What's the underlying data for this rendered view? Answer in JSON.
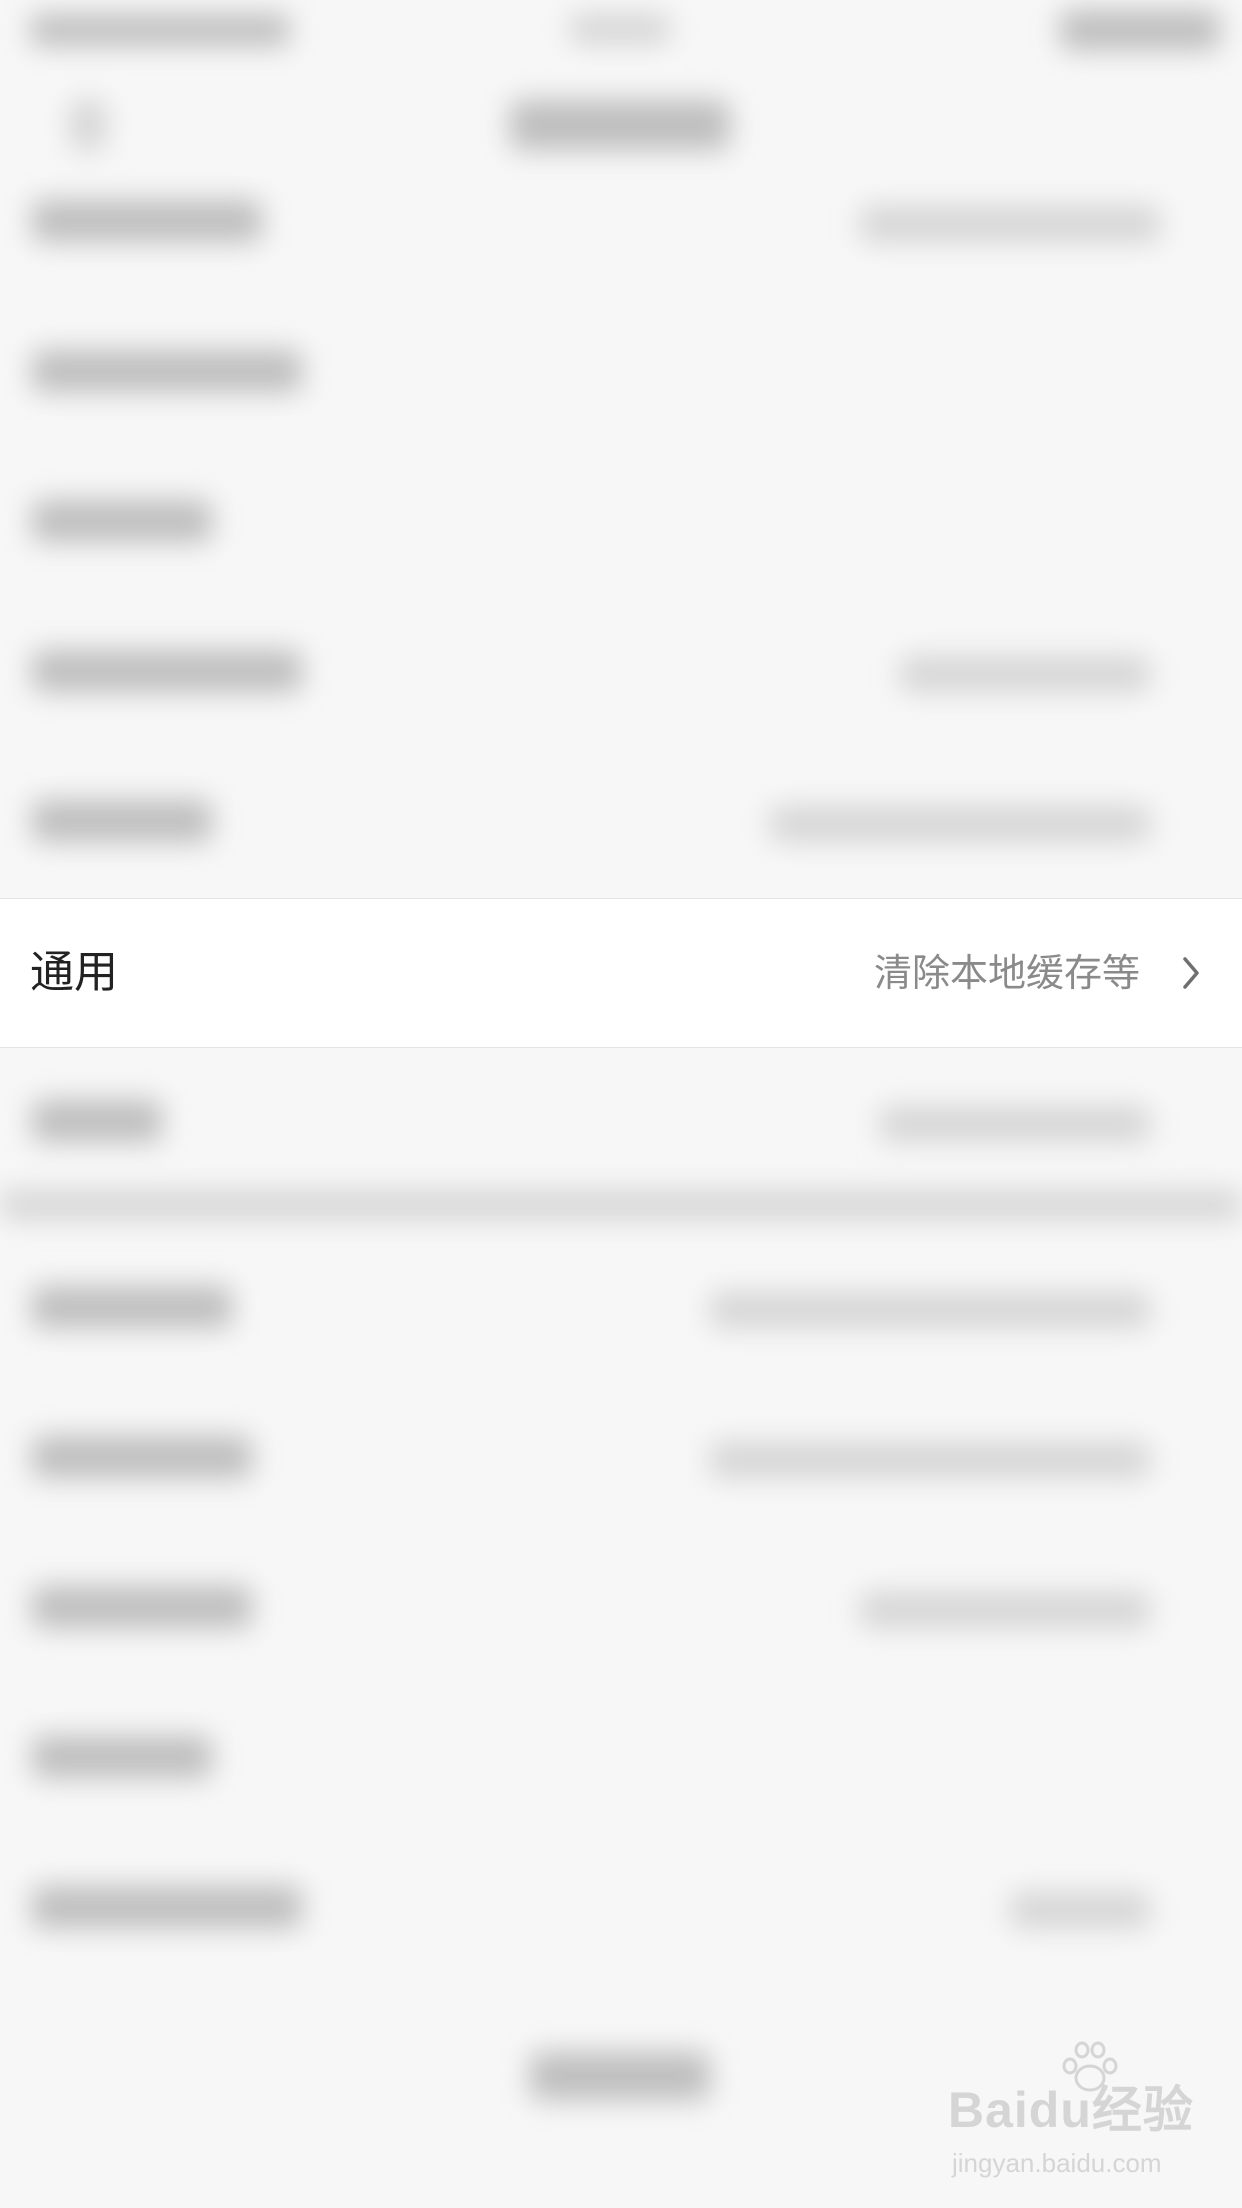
{
  "settings": {
    "focused_row": {
      "label": "通用",
      "detail": "清除本地缓存等"
    }
  },
  "icons": {
    "row_chevron": "chevron-right-icon",
    "watermark_logo": "baidu-paw-icon"
  },
  "watermark": {
    "brand": "Baidu经验",
    "url": "jingyan.baidu.com"
  }
}
